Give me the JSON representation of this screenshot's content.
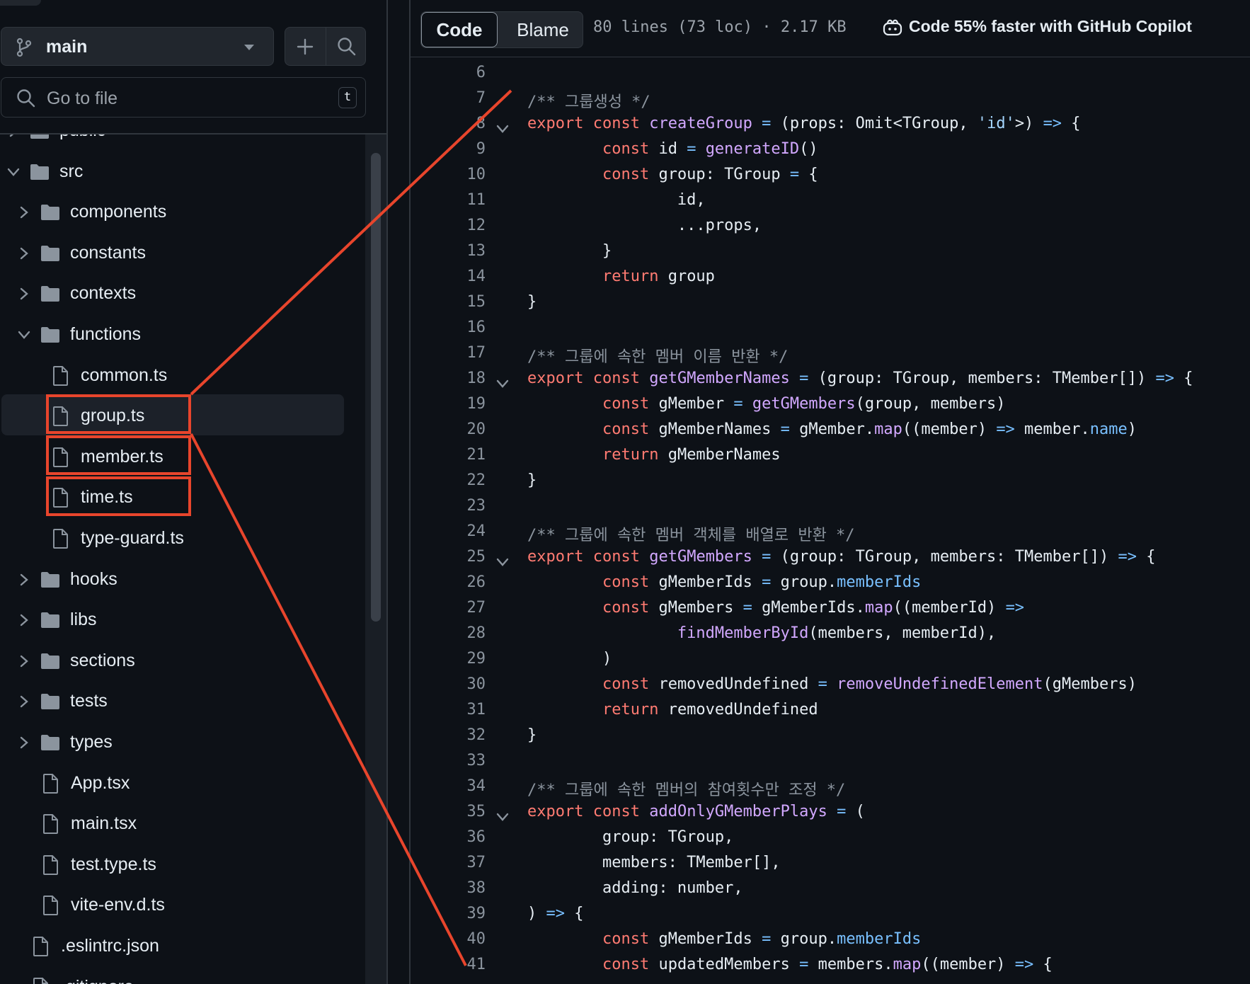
{
  "sidebar": {
    "branch": {
      "name": "main",
      "icon": "git-branch-icon"
    },
    "add_icon": "plus-icon",
    "search_icon": "search-icon",
    "go_to_file": {
      "placeholder": "Go to file",
      "shortcut": "t"
    },
    "tree": [
      {
        "label": "public",
        "type": "folder",
        "depth": 0,
        "expanded": false,
        "partially_visible": true
      },
      {
        "label": "src",
        "type": "folder",
        "depth": 0,
        "expanded": true
      },
      {
        "label": "components",
        "type": "folder",
        "depth": 1,
        "expanded": false
      },
      {
        "label": "constants",
        "type": "folder",
        "depth": 1,
        "expanded": false
      },
      {
        "label": "contexts",
        "type": "folder",
        "depth": 1,
        "expanded": false
      },
      {
        "label": "functions",
        "type": "folder",
        "depth": 1,
        "expanded": true
      },
      {
        "label": "common.ts",
        "type": "file",
        "depth": 2
      },
      {
        "label": "group.ts",
        "type": "file",
        "depth": 2,
        "selected": true,
        "highlighted": true
      },
      {
        "label": "member.ts",
        "type": "file",
        "depth": 2,
        "highlighted": true
      },
      {
        "label": "time.ts",
        "type": "file",
        "depth": 2,
        "highlighted": true
      },
      {
        "label": "type-guard.ts",
        "type": "file",
        "depth": 2
      },
      {
        "label": "hooks",
        "type": "folder",
        "depth": 1,
        "expanded": false
      },
      {
        "label": "libs",
        "type": "folder",
        "depth": 1,
        "expanded": false
      },
      {
        "label": "sections",
        "type": "folder",
        "depth": 1,
        "expanded": false
      },
      {
        "label": "tests",
        "type": "folder",
        "depth": 1,
        "expanded": false
      },
      {
        "label": "types",
        "type": "folder",
        "depth": 1,
        "expanded": false
      },
      {
        "label": "App.tsx",
        "type": "file",
        "depth": 1
      },
      {
        "label": "main.tsx",
        "type": "file",
        "depth": 1
      },
      {
        "label": "test.type.ts",
        "type": "file",
        "depth": 1
      },
      {
        "label": "vite-env.d.ts",
        "type": "file",
        "depth": 1
      },
      {
        "label": ".eslintrc.json",
        "type": "file",
        "depth": 0
      },
      {
        "label": ".gitignore",
        "type": "file",
        "depth": 0,
        "partially_visible": true
      }
    ]
  },
  "file_header": {
    "tabs": [
      {
        "label": "Code",
        "active": true
      },
      {
        "label": "Blame",
        "active": false
      }
    ],
    "info": "80 lines (73 loc) · 2.17 KB",
    "copilot_icon": "copilot-icon",
    "copilot_text": "Code 55% faster with GitHub Copilot"
  },
  "code_lines": [
    {
      "n": 6,
      "fold": false,
      "tokens": []
    },
    {
      "n": 7,
      "fold": false,
      "tokens": [
        [
          "comment",
          "/** 그룹생성 */"
        ]
      ]
    },
    {
      "n": 8,
      "fold": true,
      "tokens": [
        [
          "keyword",
          "export"
        ],
        [
          "plain",
          " "
        ],
        [
          "keyword",
          "const"
        ],
        [
          "plain",
          " "
        ],
        [
          "fn",
          "createGroup"
        ],
        [
          "plain",
          " "
        ],
        [
          "op",
          "="
        ],
        [
          "plain",
          " (props: Omit<TGroup, "
        ],
        [
          "string",
          "'id'"
        ],
        [
          "plain",
          ">) "
        ],
        [
          "op",
          "=>"
        ],
        [
          "plain",
          " {"
        ]
      ]
    },
    {
      "n": 9,
      "fold": false,
      "tokens": [
        [
          "plain",
          "        "
        ],
        [
          "keyword",
          "const"
        ],
        [
          "plain",
          " id "
        ],
        [
          "op",
          "="
        ],
        [
          "plain",
          " "
        ],
        [
          "fn",
          "generateID"
        ],
        [
          "plain",
          "()"
        ]
      ]
    },
    {
      "n": 10,
      "fold": false,
      "tokens": [
        [
          "plain",
          "        "
        ],
        [
          "keyword",
          "const"
        ],
        [
          "plain",
          " group: TGroup "
        ],
        [
          "op",
          "="
        ],
        [
          "plain",
          " {"
        ]
      ]
    },
    {
      "n": 11,
      "fold": false,
      "tokens": [
        [
          "plain",
          "                id,"
        ]
      ]
    },
    {
      "n": 12,
      "fold": false,
      "tokens": [
        [
          "plain",
          "                ...props,"
        ]
      ]
    },
    {
      "n": 13,
      "fold": false,
      "tokens": [
        [
          "plain",
          "        }"
        ]
      ]
    },
    {
      "n": 14,
      "fold": false,
      "tokens": [
        [
          "plain",
          "        "
        ],
        [
          "keyword",
          "return"
        ],
        [
          "plain",
          " group"
        ]
      ]
    },
    {
      "n": 15,
      "fold": false,
      "tokens": [
        [
          "plain",
          "}"
        ]
      ]
    },
    {
      "n": 16,
      "fold": false,
      "tokens": []
    },
    {
      "n": 17,
      "fold": false,
      "tokens": [
        [
          "comment",
          "/** 그룹에 속한 멤버 이름 반환 */"
        ]
      ]
    },
    {
      "n": 18,
      "fold": true,
      "tokens": [
        [
          "keyword",
          "export"
        ],
        [
          "plain",
          " "
        ],
        [
          "keyword",
          "const"
        ],
        [
          "plain",
          " "
        ],
        [
          "fn",
          "getGMemberNames"
        ],
        [
          "plain",
          " "
        ],
        [
          "op",
          "="
        ],
        [
          "plain",
          " (group: TGroup, members: TMember[]) "
        ],
        [
          "op",
          "=>"
        ],
        [
          "plain",
          " {"
        ]
      ]
    },
    {
      "n": 19,
      "fold": false,
      "tokens": [
        [
          "plain",
          "        "
        ],
        [
          "keyword",
          "const"
        ],
        [
          "plain",
          " gMember "
        ],
        [
          "op",
          "="
        ],
        [
          "plain",
          " "
        ],
        [
          "fn",
          "getGMembers"
        ],
        [
          "plain",
          "(group, members)"
        ]
      ]
    },
    {
      "n": 20,
      "fold": false,
      "tokens": [
        [
          "plain",
          "        "
        ],
        [
          "keyword",
          "const"
        ],
        [
          "plain",
          " gMemberNames "
        ],
        [
          "op",
          "="
        ],
        [
          "plain",
          " gMember."
        ],
        [
          "fn",
          "map"
        ],
        [
          "plain",
          "((member) "
        ],
        [
          "op",
          "=>"
        ],
        [
          "plain",
          " member."
        ],
        [
          "prop",
          "name"
        ],
        [
          "plain",
          ")"
        ]
      ]
    },
    {
      "n": 21,
      "fold": false,
      "tokens": [
        [
          "plain",
          "        "
        ],
        [
          "keyword",
          "return"
        ],
        [
          "plain",
          " gMemberNames"
        ]
      ]
    },
    {
      "n": 22,
      "fold": false,
      "tokens": [
        [
          "plain",
          "}"
        ]
      ]
    },
    {
      "n": 23,
      "fold": false,
      "tokens": []
    },
    {
      "n": 24,
      "fold": false,
      "tokens": [
        [
          "comment",
          "/** 그룹에 속한 멤버 객체를 배열로 반환 */"
        ]
      ]
    },
    {
      "n": 25,
      "fold": true,
      "tokens": [
        [
          "keyword",
          "export"
        ],
        [
          "plain",
          " "
        ],
        [
          "keyword",
          "const"
        ],
        [
          "plain",
          " "
        ],
        [
          "fn",
          "getGMembers"
        ],
        [
          "plain",
          " "
        ],
        [
          "op",
          "="
        ],
        [
          "plain",
          " (group: TGroup, members: TMember[]) "
        ],
        [
          "op",
          "=>"
        ],
        [
          "plain",
          " {"
        ]
      ]
    },
    {
      "n": 26,
      "fold": false,
      "tokens": [
        [
          "plain",
          "        "
        ],
        [
          "keyword",
          "const"
        ],
        [
          "plain",
          " gMemberIds "
        ],
        [
          "op",
          "="
        ],
        [
          "plain",
          " group."
        ],
        [
          "prop",
          "memberIds"
        ]
      ]
    },
    {
      "n": 27,
      "fold": false,
      "tokens": [
        [
          "plain",
          "        "
        ],
        [
          "keyword",
          "const"
        ],
        [
          "plain",
          " gMembers "
        ],
        [
          "op",
          "="
        ],
        [
          "plain",
          " gMemberIds."
        ],
        [
          "fn",
          "map"
        ],
        [
          "plain",
          "((memberId) "
        ],
        [
          "op",
          "=>"
        ]
      ]
    },
    {
      "n": 28,
      "fold": false,
      "tokens": [
        [
          "plain",
          "                "
        ],
        [
          "fn",
          "findMemberById"
        ],
        [
          "plain",
          "(members, memberId),"
        ]
      ]
    },
    {
      "n": 29,
      "fold": false,
      "tokens": [
        [
          "plain",
          "        )"
        ]
      ]
    },
    {
      "n": 30,
      "fold": false,
      "tokens": [
        [
          "plain",
          "        "
        ],
        [
          "keyword",
          "const"
        ],
        [
          "plain",
          " removedUndefined "
        ],
        [
          "op",
          "="
        ],
        [
          "plain",
          " "
        ],
        [
          "fn",
          "removeUndefinedElement"
        ],
        [
          "plain",
          "(gMembers)"
        ]
      ]
    },
    {
      "n": 31,
      "fold": false,
      "tokens": [
        [
          "plain",
          "        "
        ],
        [
          "keyword",
          "return"
        ],
        [
          "plain",
          " removedUndefined"
        ]
      ]
    },
    {
      "n": 32,
      "fold": false,
      "tokens": [
        [
          "plain",
          "}"
        ]
      ]
    },
    {
      "n": 33,
      "fold": false,
      "tokens": []
    },
    {
      "n": 34,
      "fold": false,
      "tokens": [
        [
          "comment",
          "/** 그룹에 속한 멤버의 참여횟수만 조정 */"
        ]
      ]
    },
    {
      "n": 35,
      "fold": true,
      "tokens": [
        [
          "keyword",
          "export"
        ],
        [
          "plain",
          " "
        ],
        [
          "keyword",
          "const"
        ],
        [
          "plain",
          " "
        ],
        [
          "fn",
          "addOnlyGMemberPlays"
        ],
        [
          "plain",
          " "
        ],
        [
          "op",
          "="
        ],
        [
          "plain",
          " ("
        ]
      ]
    },
    {
      "n": 36,
      "fold": false,
      "tokens": [
        [
          "plain",
          "        group: TGroup,"
        ]
      ]
    },
    {
      "n": 37,
      "fold": false,
      "tokens": [
        [
          "plain",
          "        members: TMember[],"
        ]
      ]
    },
    {
      "n": 38,
      "fold": false,
      "tokens": [
        [
          "plain",
          "        adding: number,"
        ]
      ]
    },
    {
      "n": 39,
      "fold": false,
      "tokens": [
        [
          "plain",
          ") "
        ],
        [
          "op",
          "=>"
        ],
        [
          "plain",
          " {"
        ]
      ]
    },
    {
      "n": 40,
      "fold": false,
      "tokens": [
        [
          "plain",
          "        "
        ],
        [
          "keyword",
          "const"
        ],
        [
          "plain",
          " gMemberIds "
        ],
        [
          "op",
          "="
        ],
        [
          "plain",
          " group."
        ],
        [
          "prop",
          "memberIds"
        ]
      ]
    },
    {
      "n": 41,
      "fold": false,
      "tokens": [
        [
          "plain",
          "        "
        ],
        [
          "keyword",
          "const"
        ],
        [
          "plain",
          " updatedMembers "
        ],
        [
          "op",
          "="
        ],
        [
          "plain",
          " members."
        ],
        [
          "fn",
          "map"
        ],
        [
          "plain",
          "((member) "
        ],
        [
          "op",
          "=>"
        ],
        [
          "plain",
          " {"
        ]
      ]
    }
  ],
  "colors": {
    "annotation": "#e8452c",
    "keyword": "#ff7b72",
    "function": "#d2a8ff",
    "operator": "#79c0ff",
    "string": "#a5d6ff",
    "comment": "#8b949e"
  }
}
